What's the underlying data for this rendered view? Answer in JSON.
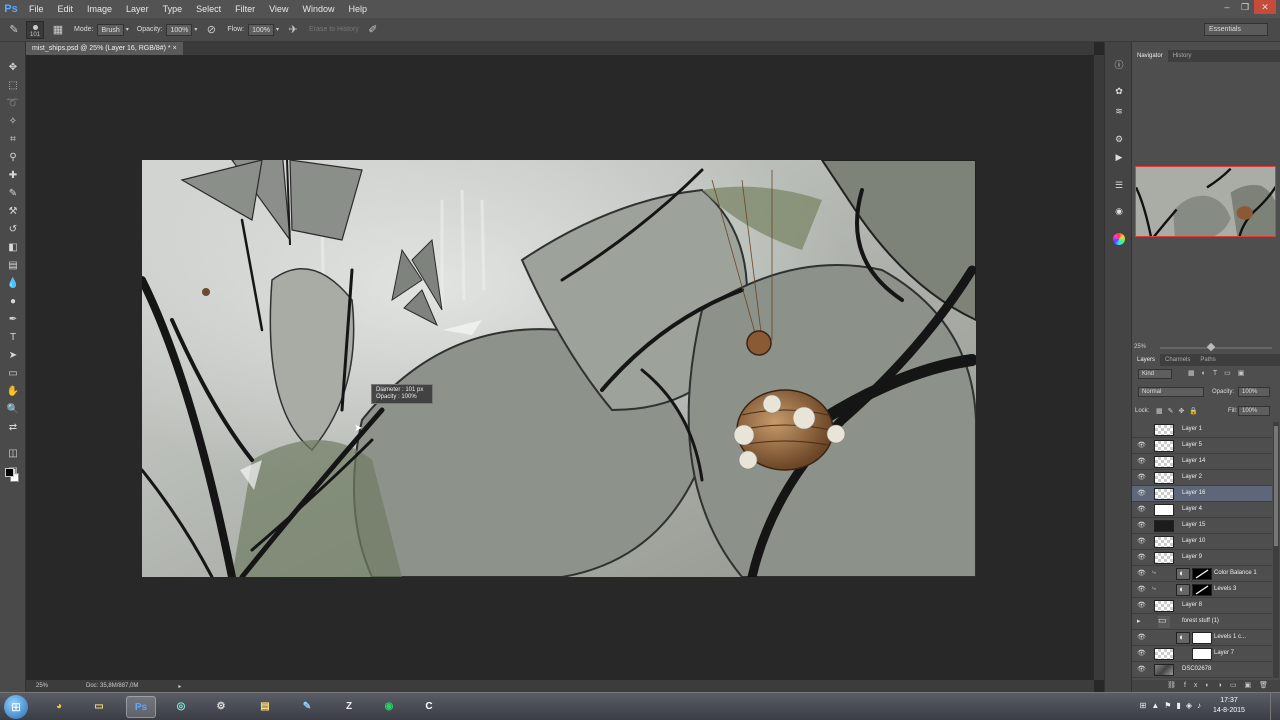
{
  "app": {
    "logo": "Ps"
  },
  "menu": [
    "File",
    "Edit",
    "Image",
    "Layer",
    "Type",
    "Select",
    "Filter",
    "View",
    "Window",
    "Help"
  ],
  "options_bar": {
    "brush_size": "101",
    "mode_label": "Mode:",
    "mode_value": "Brush",
    "opacity_label": "Opacity:",
    "opacity_value": "100%",
    "flow_label": "Flow:",
    "flow_value": "100%",
    "erase_history": "Erase to History",
    "workspace": "Essentials"
  },
  "document": {
    "tab_title": "mist_ships.psd @ 25% (Layer 16, RGB/8#) *",
    "tooltip_diameter": "Diameter : 101 px",
    "tooltip_opacity": "Opacity : 100%"
  },
  "status": {
    "zoom": "25%",
    "doc": "Doc: 35,8M/887,0M"
  },
  "navigator": {
    "tabs": [
      "Navigator",
      "History"
    ],
    "zoom": "25%"
  },
  "layers_panel": {
    "tabs": [
      "Layers",
      "Channels",
      "Paths"
    ],
    "filter": "Kind",
    "blend_mode": "Normal",
    "opacity_label": "Opacity:",
    "opacity": "100%",
    "lock_label": "Lock:",
    "fill_label": "Fill:",
    "fill": "100%",
    "layers": [
      {
        "name": "Layer 1"
      },
      {
        "name": "Layer 5"
      },
      {
        "name": "Layer 14"
      },
      {
        "name": "Layer 2"
      },
      {
        "name": "Layer 16"
      },
      {
        "name": "Layer 4"
      },
      {
        "name": "Layer 15"
      },
      {
        "name": "Layer 10"
      },
      {
        "name": "Layer 9"
      },
      {
        "name": "Color Balance 1"
      },
      {
        "name": "Levels 3"
      },
      {
        "name": "Layer 8"
      },
      {
        "name": "forest stuff (1)"
      },
      {
        "name": "Levels 1 c..."
      },
      {
        "name": "Layer 7"
      },
      {
        "name": "DSC02678"
      }
    ]
  },
  "taskbar": {
    "time": "17:37",
    "date": "14-8-2015"
  },
  "colors": {
    "selected_layer": "#5d6779",
    "navigator_frame": "#e03c3c",
    "ps_blue": "#5aa8ff"
  }
}
